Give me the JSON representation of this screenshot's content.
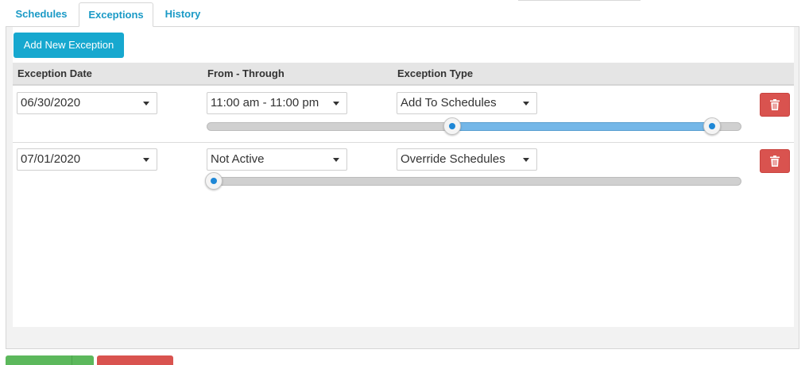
{
  "tabs": [
    {
      "label": "Schedules"
    },
    {
      "label": "Exceptions"
    },
    {
      "label": "History"
    }
  ],
  "active_tab": "Exceptions",
  "toolbar": {
    "add_label": "Add New Exception"
  },
  "table": {
    "headers": {
      "date": "Exception Date",
      "range": "From - Through",
      "type": "Exception Type"
    },
    "rows": [
      {
        "date": "06/30/2020",
        "range": "11:00 am - 11:00 pm",
        "type": "Add To Schedules",
        "slider": {
          "start_fraction": 0.458,
          "end_fraction": 0.958,
          "active": true
        }
      },
      {
        "date": "07/01/2020",
        "range": "Not Active",
        "type": "Override Schedules",
        "slider": {
          "start_fraction": 0.0,
          "end_fraction": 0.0,
          "active": false
        }
      }
    ]
  },
  "colors": {
    "tab_text": "#1a9ac6",
    "add_button": "#17a8cf",
    "delete_button": "#d9534f",
    "slider_range": "#74b7e8",
    "handle_dot": "#1e87d6"
  },
  "icons": {
    "delete": "trash-icon",
    "dropdown": "caret-down-icon"
  }
}
